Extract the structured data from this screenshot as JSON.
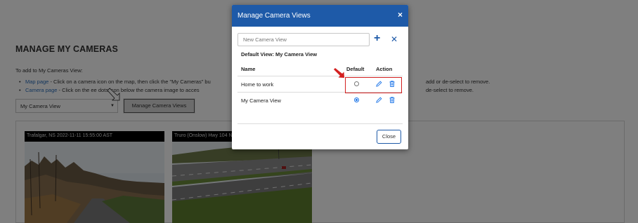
{
  "page": {
    "title": "MANAGE MY CAMERAS",
    "intro": "To add to My Cameras View:",
    "bullets": [
      {
        "link": "Map page",
        "text": " - Click on a camera icon on the map, then click the \"My Cameras\" bu",
        "rest": "add or de-select to remove."
      },
      {
        "link": "Camera page",
        "text": " - Click on the         ee dots icon below the camera image to acces",
        "rest": "de-select to remove."
      }
    ],
    "select_value": "My Camera View",
    "manage_button": "Manage Camera Views",
    "cameras": [
      {
        "caption": "Trafalgar, NS 2022-11-11 15:55:00 AST"
      },
      {
        "caption": "Truro (Onslow) Hwy 104 N..."
      }
    ]
  },
  "modal": {
    "title": "Manage Camera Views",
    "close_icon": "×",
    "input_placeholder": "New Camera View",
    "add_icon": "+",
    "cancel_icon": "✕",
    "default_view_label": "Default View: My Camera View",
    "columns": {
      "name": "Name",
      "default": "Default",
      "action": "Action"
    },
    "rows": [
      {
        "name": "Home to work",
        "default": false
      },
      {
        "name": "My Camera View",
        "default": true
      }
    ],
    "close_button": "Close"
  },
  "colors": {
    "header_blue": "#1e5aa8",
    "action_blue": "#1a73e8",
    "highlight_red": "#d32020"
  }
}
